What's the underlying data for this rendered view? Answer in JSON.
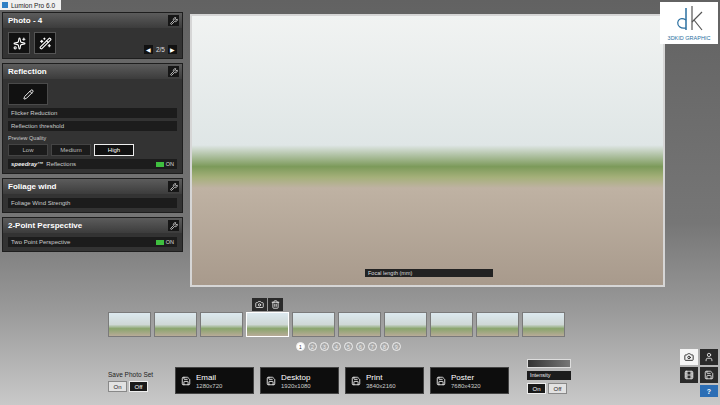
{
  "window": {
    "title": "Lumion Pro 6.0"
  },
  "logo": {
    "text": "3DKID GRAPHIC"
  },
  "photo_panel": {
    "title": "Photo - 4",
    "prev": "◀",
    "page": "2/5",
    "next": "▶"
  },
  "reflection": {
    "title": "Reflection",
    "fields": [
      "Flicker Reduction",
      "Reflection threshold"
    ],
    "preview_label": "Preview Quality",
    "quality": [
      {
        "label": "Low",
        "selected": false
      },
      {
        "label": "Medium",
        "selected": false
      },
      {
        "label": "High",
        "selected": true
      }
    ],
    "toggle": {
      "brand": "speedray™",
      "label": "Reflections",
      "on": true,
      "text": "ON"
    }
  },
  "foliage": {
    "title": "Foliage wind",
    "fields": [
      "Foliage Wind Strength"
    ]
  },
  "perspective": {
    "title": "2-Point Perspective",
    "toggle": {
      "label": "Two Point Perspective",
      "on": true,
      "text": "ON"
    }
  },
  "viewport": {
    "slider_label": "Focal length (mm)"
  },
  "thumbnails": [
    {
      "selected": false
    },
    {
      "selected": false
    },
    {
      "selected": false
    },
    {
      "selected": true
    },
    {
      "selected": false
    },
    {
      "selected": false
    },
    {
      "selected": false
    },
    {
      "selected": false
    },
    {
      "selected": false
    },
    {
      "selected": false
    }
  ],
  "pages": [
    {
      "label": "1",
      "selected": true
    },
    {
      "label": "2",
      "selected": false
    },
    {
      "label": "3",
      "selected": false
    },
    {
      "label": "4",
      "selected": false
    },
    {
      "label": "5",
      "selected": false
    },
    {
      "label": "6",
      "selected": false
    },
    {
      "label": "7",
      "selected": false
    },
    {
      "label": "8",
      "selected": false
    },
    {
      "label": "9",
      "selected": false
    }
  ],
  "save_photo_set": {
    "label": "Save Photo Set",
    "options": [
      {
        "label": "On",
        "selected": false
      },
      {
        "label": "Off",
        "selected": true
      }
    ]
  },
  "render_buttons": [
    {
      "label": "Email",
      "size": "1280x720"
    },
    {
      "label": "Desktop",
      "size": "1920x1080"
    },
    {
      "label": "Print",
      "size": "3840x2160"
    },
    {
      "label": "Poster",
      "size": "7680x4320"
    }
  ],
  "intensity_box": {
    "label": "Intensity",
    "options": [
      {
        "label": "On",
        "selected": true
      },
      {
        "label": "Off",
        "selected": false
      }
    ]
  },
  "mode_buttons": [
    {
      "kind": "photo",
      "selected": true
    },
    {
      "kind": "walk",
      "selected": false
    },
    {
      "kind": "movie",
      "selected": false
    },
    {
      "kind": "save",
      "selected": false
    }
  ],
  "help": "?"
}
